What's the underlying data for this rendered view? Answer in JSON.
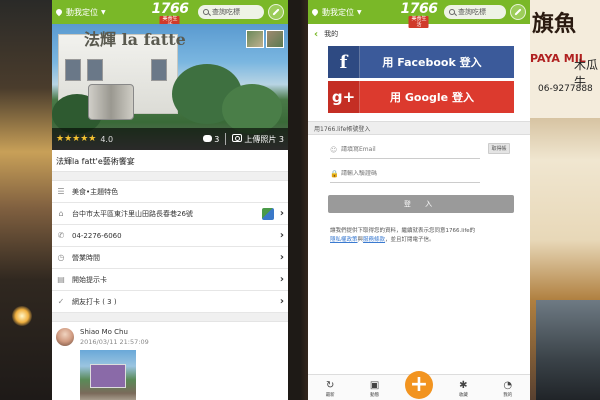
{
  "colors": {
    "brand_green": "#7ab828",
    "facebook_blue": "#3b5a9a",
    "google_red": "#dc3a2e",
    "plus_orange": "#f29420"
  },
  "background": {
    "sign_main": "旗魚",
    "sign_sub": "PAYA MIL",
    "sign_side": "木瓜牛",
    "sign_phone": "06-9277888"
  },
  "header": {
    "location_label": "動我定位",
    "logo_number": "1766",
    "logo_sub": "美食生活",
    "search_placeholder": "查詢吃標"
  },
  "left": {
    "photo": {
      "sign_text": "法輝 la fatte",
      "stars": "★★★★★",
      "rating": "4.0",
      "comments_count": "3",
      "upload_label": "上傳照片 3"
    },
    "place_name": "法輝la fatt'e藝術饗宴",
    "rows": {
      "category": "美食•主題特色",
      "address": "台中市太平區東汴里山田路長春巷26號",
      "phone": "04-2276-6060",
      "hours": "營業時間",
      "offer_card": "開始提示卡",
      "checkins": "網友打卡 ( 3 )"
    },
    "review": {
      "name": "Shiao Mo Chu",
      "date": "2016/03/11 21:57:09"
    }
  },
  "right": {
    "back_label": "我的",
    "facebook_label": "用 Facebook 登入",
    "google_label": "用 Google 登入",
    "section_header": "用1766.life帳號登入",
    "email_placeholder": "請填寫Email",
    "email_action": "取得帳",
    "password_placeholder": "請輸入驗證碼",
    "submit_label": "登 入",
    "terms_text": "繼續就表示您同意1766.life的",
    "terms_prefix": "讓我們提供下取得您的資料，",
    "privacy_link": "隱私權政策",
    "and_text": "與",
    "service_link": "服務條款",
    "terms_suffix": "，並且訂閱電子信。",
    "nav": {
      "item1": "最新",
      "item2": "動態",
      "item4": "收藏",
      "item5": "我的"
    }
  }
}
